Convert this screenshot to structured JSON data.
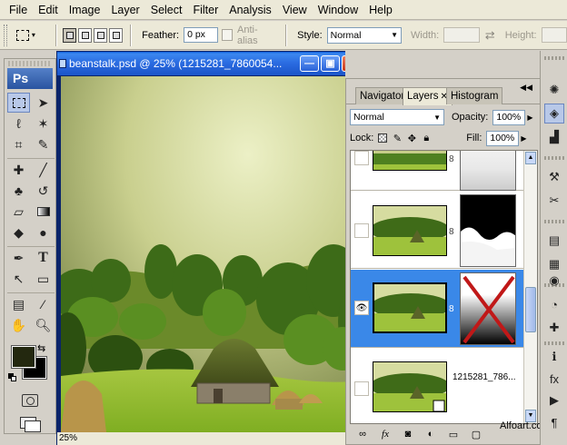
{
  "menu": [
    "File",
    "Edit",
    "Image",
    "Layer",
    "Select",
    "Filter",
    "Analysis",
    "View",
    "Window",
    "Help"
  ],
  "options": {
    "feather_label": "Feather:",
    "feather_value": "0 px",
    "antialias_label": "Anti-alias",
    "style_label": "Style:",
    "style_value": "Normal",
    "width_label": "Width:",
    "height_label": "Height:"
  },
  "tools": {
    "logo": "Ps"
  },
  "document": {
    "title": "beanstalk.psd @ 25% (1215281_7860054...",
    "zoom": "25%",
    "buttons": {
      "minimize": "—",
      "restore": "▣",
      "close": "✕"
    }
  },
  "layers_panel": {
    "tabs": [
      "Navigator",
      "Layers",
      "Histogram"
    ],
    "blend_mode": "Normal",
    "opacity_label": "Opacity:",
    "opacity_value": "100%",
    "lock_label": "Lock:",
    "fill_label": "Fill:",
    "fill_value": "100%",
    "layers": [
      {
        "name": ""
      },
      {
        "name": ""
      },
      {
        "name": ""
      },
      {
        "name": "1215281_786..."
      }
    ]
  },
  "watermark": "Alfoart.com",
  "colors": {
    "foreground": "#23280f",
    "background": "#000000",
    "selection": "#3a88e8",
    "title_bar": "#2a6ae0"
  }
}
